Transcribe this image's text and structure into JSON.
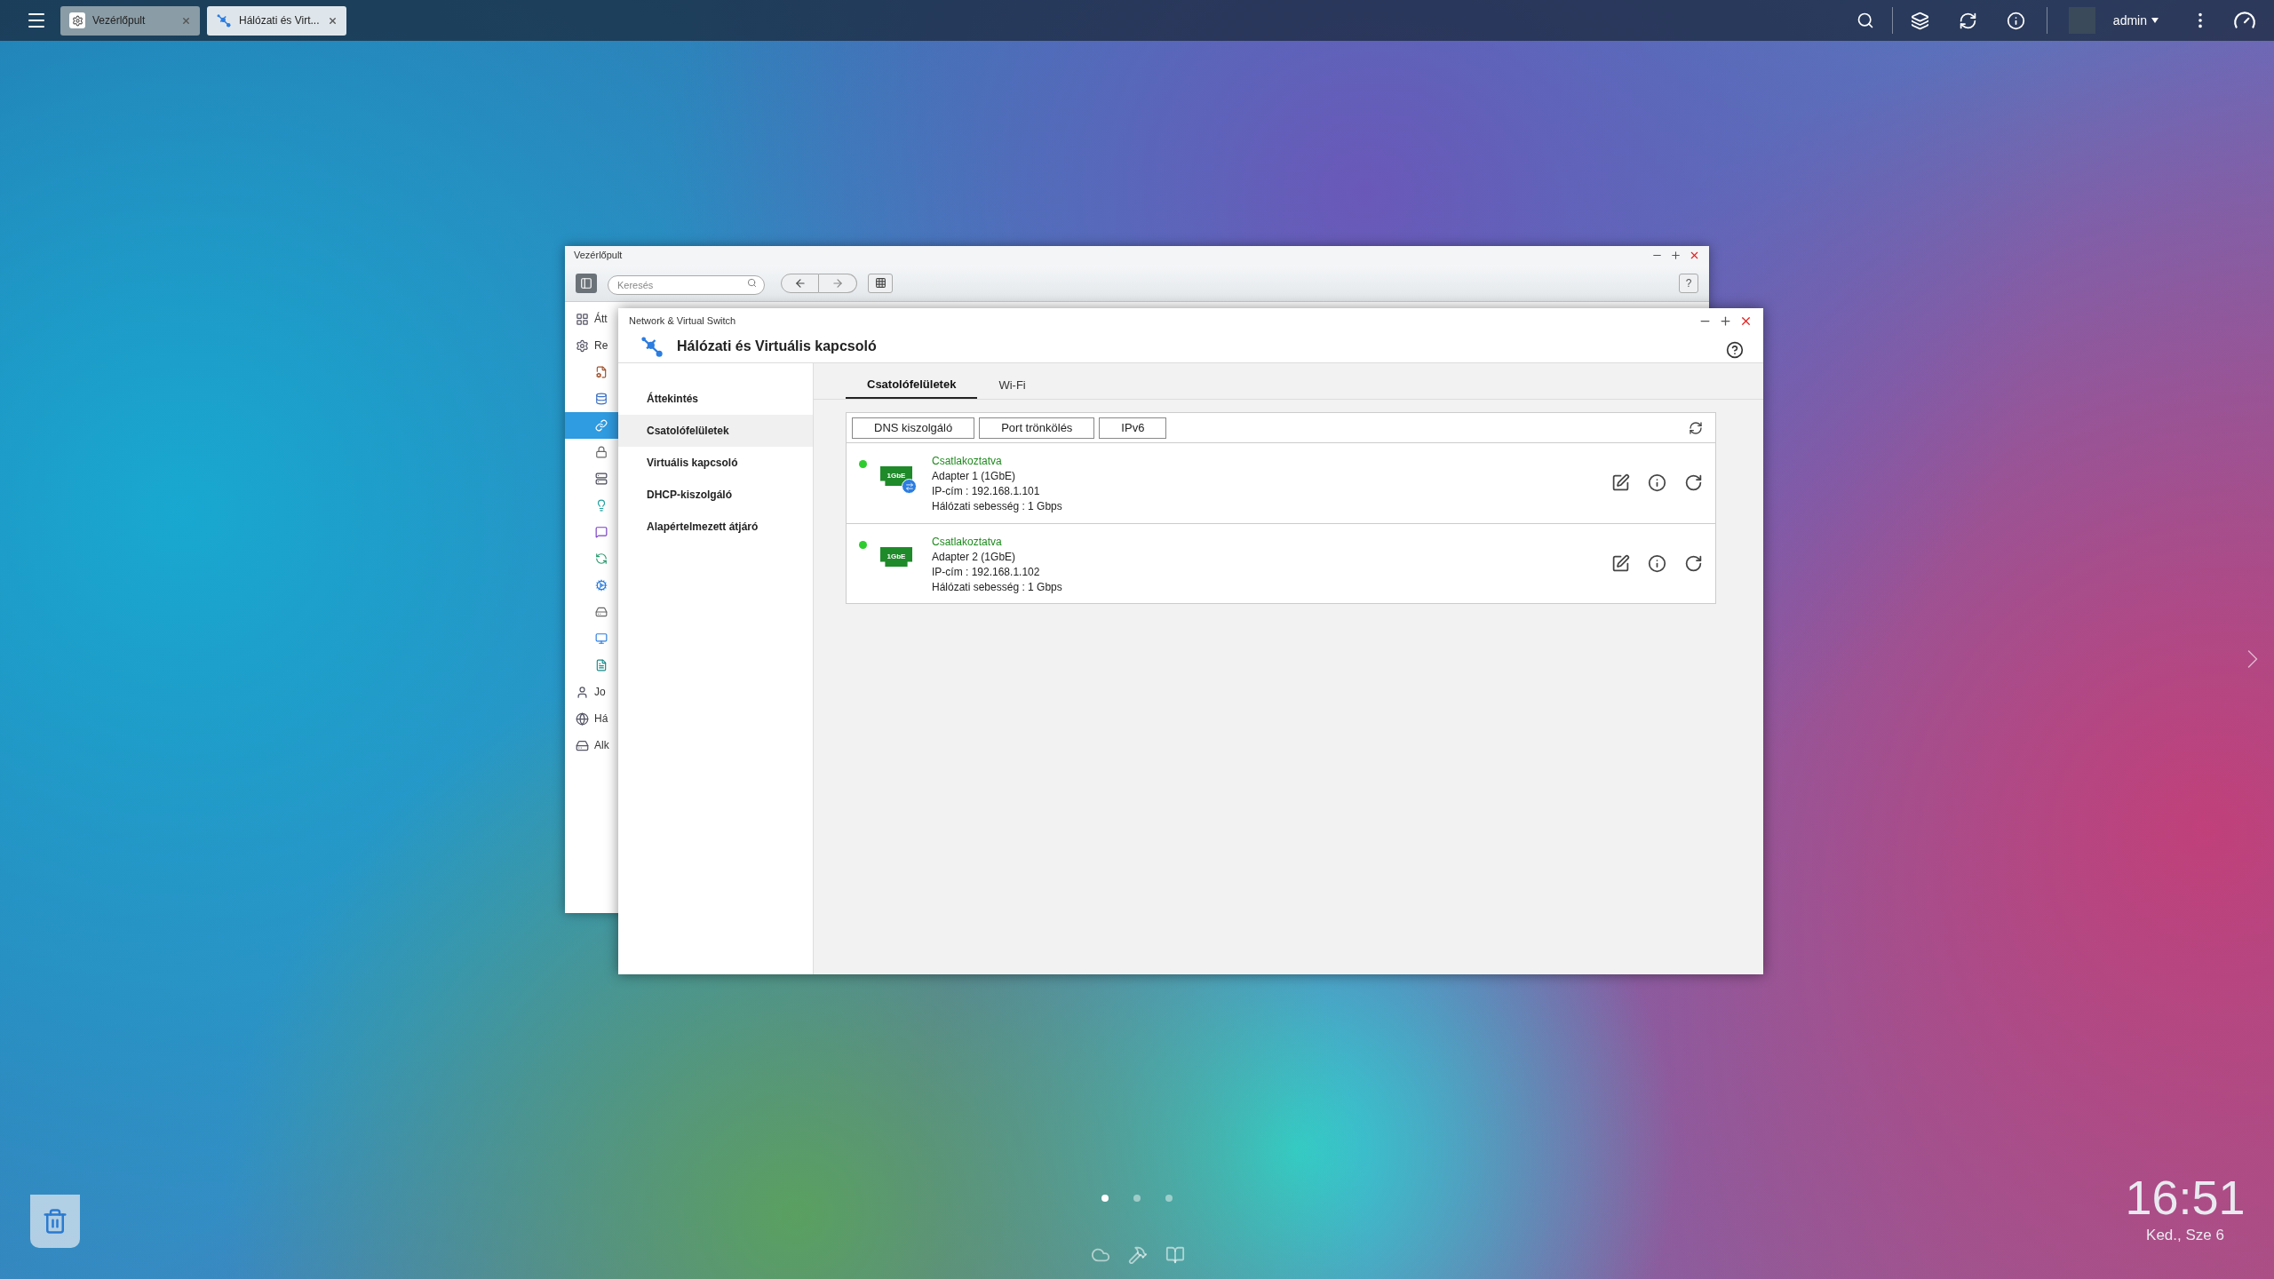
{
  "taskbar": {
    "tabs": [
      {
        "label": "Vezérlőpult",
        "selected": false
      },
      {
        "label": "Hálózati és Virt...",
        "selected": true
      }
    ],
    "user": "admin"
  },
  "back_window": {
    "title": "Vezérlőpult",
    "search": {
      "placeholder": "Keresés"
    },
    "help": "?",
    "sidebar": [
      {
        "kind": "group",
        "label": "Átt",
        "selected": false
      },
      {
        "kind": "group",
        "label": "Re",
        "selected": false
      },
      {
        "kind": "sub",
        "selected": false
      },
      {
        "kind": "sub",
        "selected": false
      },
      {
        "kind": "sub",
        "selected": true
      },
      {
        "kind": "sub",
        "selected": false
      },
      {
        "kind": "sub",
        "selected": false
      },
      {
        "kind": "sub",
        "selected": false
      },
      {
        "kind": "sub",
        "selected": false
      },
      {
        "kind": "sub",
        "selected": false
      },
      {
        "kind": "sub",
        "selected": false
      },
      {
        "kind": "sub",
        "selected": false
      },
      {
        "kind": "sub",
        "selected": false
      },
      {
        "kind": "sub",
        "selected": false
      },
      {
        "kind": "group",
        "label": "Jo",
        "selected": false
      },
      {
        "kind": "group",
        "label": "Há",
        "selected": false
      },
      {
        "kind": "group",
        "label": "Alk",
        "selected": false
      }
    ]
  },
  "front_window": {
    "title": "Network & Virtual Switch",
    "heading": "Hálózati és Virtuális kapcsoló",
    "sidebar": [
      {
        "label": "Áttekintés",
        "selected": false
      },
      {
        "label": "Csatolófelületek",
        "selected": true
      },
      {
        "label": "Virtuális kapcsoló",
        "selected": false
      },
      {
        "label": "DHCP-kiszolgáló",
        "selected": false
      },
      {
        "label": "Alapértelmezett átjáró",
        "selected": false
      }
    ],
    "tabs": [
      {
        "label": "Csatolófelületek",
        "selected": true
      },
      {
        "label": "Wi-Fi",
        "selected": false
      }
    ],
    "toolbar": [
      "DNS kiszolgáló",
      "Port trönkölés",
      "IPv6"
    ],
    "adapters": [
      {
        "status": "Csatlakoztatva",
        "connected": true,
        "badge": "1GbE",
        "virtual_switch": true,
        "name": "Adapter 1 (1GbE)",
        "ip": "IP-cím : 192.168.1.101",
        "speed": "Hálózati sebesség : 1 Gbps"
      },
      {
        "status": "Csatlakoztatva",
        "connected": true,
        "badge": "1GbE",
        "virtual_switch": false,
        "name": "Adapter 2 (1GbE)",
        "ip": "IP-cím : 192.168.1.102",
        "speed": "Hálózati sebesség : 1 Gbps"
      }
    ]
  },
  "desktop": {
    "pages": [
      {
        "selected": true
      },
      {
        "selected": false
      },
      {
        "selected": false
      }
    ],
    "clock": {
      "time": "16:51",
      "date": "Ked., Sze 6"
    }
  }
}
